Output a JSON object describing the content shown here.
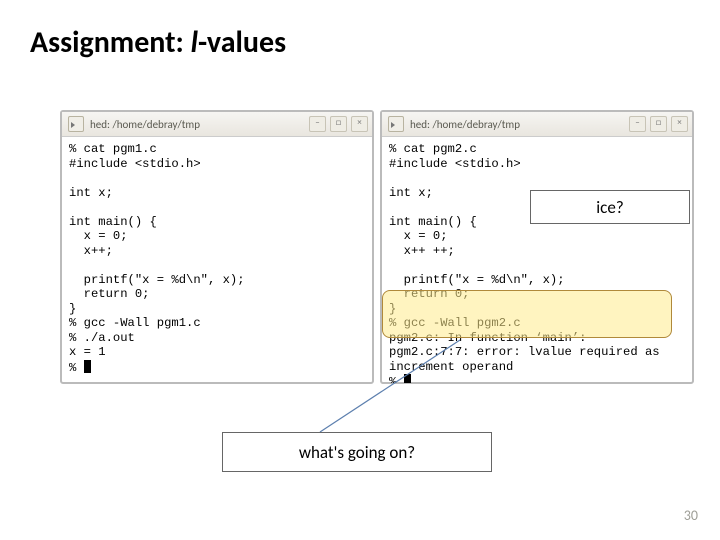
{
  "title_prefix": "Assignment: ",
  "title_italic": "l",
  "title_suffix": "-values",
  "window_title_left": "hed: /home/debray/tmp",
  "window_title_right": "hed: /home/debray/tmp",
  "win_min": "–",
  "win_max": "□",
  "win_close": "×",
  "term_left": "% cat pgm1.c\n#include <stdio.h>\n\nint x;\n\nint main() {\n  x = 0;\n  x++;\n\n  printf(\"x = %d\\n\", x);\n  return 0;\n}\n% gcc -Wall pgm1.c\n% ./a.out\nx = 1\n% ",
  "term_right_pre": "% cat pgm2.c\n#include <stdio.h>\n\nint x;\n\nint main() {\n  x = 0;\n  x++ ++;\n\n  printf(\"x = %d\\n\", x);\n  return 0;\n}\n",
  "term_right_hl": "% gcc -Wall pgm2.c\npgm2.c: In function ‘main’:\npgm2.c:7:7: error: lvalue required as\nincrement operand",
  "term_right_post": "\n% ",
  "callout_right": "ice?",
  "callout_bottom": "what's going on?",
  "page_number": "30"
}
